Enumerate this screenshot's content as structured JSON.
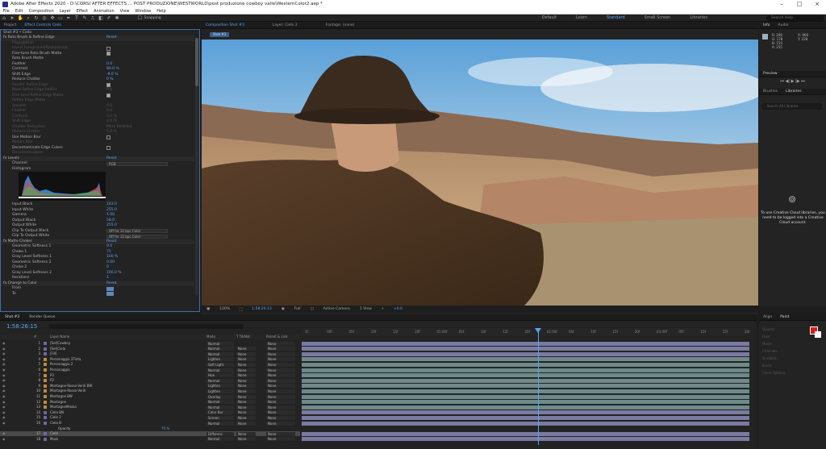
{
  "window": {
    "title": "Adobe After Effects 2020 - D:\\CORSI AFTER EFFECTS ... POST PRODUZIONE\\WESTWORLD\\post produzione cowboy valle\\WesternColor2.aep *"
  },
  "menu": [
    "File",
    "Edit",
    "Composition",
    "Layer",
    "Effect",
    "Animation",
    "View",
    "Window",
    "Help"
  ],
  "toolbar": {
    "snapping": "Snapping"
  },
  "workspaces": [
    {
      "label": "Default"
    },
    {
      "label": "Learn"
    },
    {
      "label": "Standard",
      "active": true
    },
    {
      "label": "Small Screen"
    },
    {
      "label": "Libraries"
    }
  ],
  "search": {
    "placeholder": "Search Help"
  },
  "effect_panel": {
    "tabs": [
      "Project",
      "Effect Controls Cielo"
    ],
    "breadcrumb": "Shot #3 • Cielo",
    "rows": [
      {
        "label": "fx  Roto Brush & Refine Edge",
        "value": "Reset",
        "kind": "sect"
      },
      {
        "label": "Propagation",
        "dim": true
      },
      {
        "label": "Invert Foreground/Background",
        "dim": true,
        "check": false
      },
      {
        "label": "Fine-tune Roto Brush Matte",
        "check": true
      },
      {
        "label": "Roto Brush Matte"
      },
      {
        "label": "Feather",
        "value": "0.0"
      },
      {
        "label": "Contrast",
        "value": "80.0 %"
      },
      {
        "label": "Shift Edge",
        "value": "-9.0 %"
      },
      {
        "label": "Reduce Chatter",
        "value": "0 %"
      },
      {
        "label": "Render Refine Edge",
        "dim": true,
        "check": true
      },
      {
        "label": "Base Refine Edge Radius",
        "dim": true,
        "value": "0.0"
      },
      {
        "label": "Fine-tune Refine Edge Matte",
        "dim": true,
        "check": true
      },
      {
        "label": "Refine Edge Matte",
        "dim": true
      },
      {
        "label": "Smooth",
        "dim": true,
        "value": "0.0"
      },
      {
        "label": "Feather",
        "dim": true,
        "value": "0.0"
      },
      {
        "label": "Contrast",
        "dim": true,
        "value": "0.0 %"
      },
      {
        "label": "Shift Edge",
        "dim": true,
        "value": "0.0 %"
      },
      {
        "label": "Chatter Reduction",
        "dim": true,
        "value": "More Detailed"
      },
      {
        "label": "Reduce Chatter",
        "dim": true,
        "value": "0.0 %"
      },
      {
        "label": "Use Motion Blur",
        "check": false
      },
      {
        "label": "Motion Blur",
        "dim": true
      },
      {
        "label": "Decontaminate Edge Colors",
        "check": false
      },
      {
        "label": "Decontamination",
        "dim": true
      },
      {
        "label": "fx  Levels",
        "value": "Reset",
        "kind": "sect"
      },
      {
        "label": "Channel:",
        "value": "RGB",
        "kind": "dropdown"
      },
      {
        "label": "Histogram",
        "kind": "histogram"
      },
      {
        "label": "Input Black",
        "value": "183.0"
      },
      {
        "label": "Input White",
        "value": "255.0"
      },
      {
        "label": "Gamma",
        "value": "1.00"
      },
      {
        "label": "Output Black",
        "value": "58.0"
      },
      {
        "label": "Output White",
        "value": "255.0"
      },
      {
        "label": "Clip To Output Black",
        "value": "Off for 32 bpc Color",
        "kind": "dropdown"
      },
      {
        "label": "Clip To Output White",
        "value": "Off for 32 bpc Color",
        "kind": "dropdown"
      },
      {
        "label": "fx  Matte Choker",
        "value": "Reset",
        "kind": "sect"
      },
      {
        "label": "Geometric Softness 1",
        "value": "0.0"
      },
      {
        "label": "Choke 1",
        "value": "75"
      },
      {
        "label": "Gray Level Softness 1",
        "value": "100 %"
      },
      {
        "label": "Geometric Softness 2",
        "value": "0.00"
      },
      {
        "label": "Choke 2",
        "value": "0"
      },
      {
        "label": "Gray Level Softness 2",
        "value": "100.0 %"
      },
      {
        "label": "Iterations",
        "value": "1"
      },
      {
        "label": "fx  Change to Color",
        "value": "Reset",
        "kind": "sect"
      },
      {
        "label": "From",
        "kind": "swatch"
      },
      {
        "label": "To",
        "kind": "swatch"
      }
    ]
  },
  "composition": {
    "tabs": [
      "Composition Shot #3",
      "Layer: Cielo 2",
      "Footage: (none)"
    ],
    "shot_label": "Shot #3",
    "viewer_bar": {
      "zoom": "100%",
      "timecode": "1:58:26:15",
      "resolution": "Full",
      "camera": "Active Camera",
      "views": "1 View",
      "exposure": "+0.0"
    }
  },
  "info_panel": {
    "tabs": [
      "Info",
      "Audio"
    ],
    "r": "R: 206",
    "g": "G: 178",
    "b": "B: 150",
    "a": "A: 255",
    "x": "X: 906",
    "y": "Y: 228"
  },
  "preview_panel": {
    "title": "Preview"
  },
  "libraries_panel": {
    "tabs": [
      "Brushes",
      "Libraries"
    ],
    "search": "Search All Libraries",
    "message": "To use Creative Cloud libraries, you need to be logged into a Creative Cloud account."
  },
  "align_panel": {
    "tabs": [
      "Align",
      "Paint"
    ],
    "opacity": "Opacity:",
    "flow": "Flow:",
    "mode": "Mode:",
    "channels": "Channels:",
    "duration": "Duration:",
    "erase": "Erase:",
    "clone": "Clone Options"
  },
  "timeline": {
    "tabs": [
      "Shot #3",
      "Render Queue"
    ],
    "timecode": "1:58:26:15",
    "columns": [
      "#",
      "Layer Name",
      "Mode",
      "T TrkMat",
      "Parent & Link"
    ],
    "ruler": [
      "1f",
      "00f",
      "05f",
      "10f",
      "15f",
      "20f",
      "01:00f",
      "05f",
      "10f",
      "15f",
      "20f",
      "02:00f",
      "05f",
      "10f",
      "15f",
      "20f",
      "03:00f",
      "05f",
      "10f",
      "15f",
      "20f"
    ],
    "layers": [
      {
        "num": "1",
        "name": "[Sel]Cowboy",
        "mode": "Normal",
        "trk": "",
        "parent": "None",
        "color": "#6a6aa0"
      },
      {
        "num": "2",
        "name": "[Sel]Cielo",
        "mode": "Normal",
        "trk": "None",
        "parent": "None",
        "color": "#6a6aa0"
      },
      {
        "num": "3",
        "name": "[Fill]",
        "mode": "Normal",
        "trk": "None",
        "parent": "None",
        "color": "#6a6aa0"
      },
      {
        "num": "4",
        "name": "Personaggio 3Tinta",
        "mode": "Lighten",
        "trk": "None",
        "parent": "None",
        "color": "#c08a3a"
      },
      {
        "num": "5",
        "name": "Personaggio 2",
        "mode": "Soft Light",
        "trk": "None",
        "parent": "None",
        "color": "#c08a3a"
      },
      {
        "num": "6",
        "name": "Personaggio",
        "mode": "Normal",
        "trk": "None",
        "parent": "None",
        "color": "#c08a3a"
      },
      {
        "num": "7",
        "name": "P3",
        "mode": "Hue",
        "trk": "None",
        "parent": "None",
        "color": "#c08a3a"
      },
      {
        "num": "8",
        "name": "P2",
        "mode": "Normal",
        "trk": "None",
        "parent": "None",
        "color": "#c08a3a"
      },
      {
        "num": "9",
        "name": "Montagne-Rosso-Verdi BW",
        "mode": "Lighten",
        "trk": "None",
        "parent": "None",
        "color": "#c08a3a"
      },
      {
        "num": "10",
        "name": "Montagne-Rosso-Verdi",
        "mode": "Lighten",
        "trk": "None",
        "parent": "None",
        "color": "#c08a3a"
      },
      {
        "num": "11",
        "name": "Montagne BW",
        "mode": "Overlay",
        "trk": "None",
        "parent": "None",
        "color": "#c08a3a"
      },
      {
        "num": "12",
        "name": "Montagne",
        "mode": "Normal",
        "trk": "None",
        "parent": "None",
        "color": "#c08a3a"
      },
      {
        "num": "13",
        "name": "MontagneMaska",
        "mode": "Normal",
        "trk": "None",
        "parent": "None",
        "color": "#c08a3a"
      },
      {
        "num": "14",
        "name": "Cielo BN",
        "mode": "Color Bur",
        "trk": "None",
        "parent": "None",
        "color": "#6a6aa0"
      },
      {
        "num": "15",
        "name": "Cielo 2",
        "mode": "Screen",
        "trk": "None",
        "parent": "None",
        "color": "#6a6aa0"
      },
      {
        "num": "16",
        "name": "Cielo B",
        "mode": "Normal",
        "trk": "None",
        "parent": "None",
        "color": "#6a6aa0"
      },
      {
        "num": "",
        "name": "Opacity",
        "mode": "",
        "trk": "",
        "parent": "",
        "color": "",
        "value": "75 %"
      },
      {
        "num": "17",
        "name": "Cielo",
        "mode": "Differenc",
        "trk": "None",
        "parent": "None",
        "color": "#6a6aa0",
        "selected": true
      },
      {
        "num": "18",
        "name": "Mask",
        "mode": "Normal",
        "trk": "None",
        "parent": "None",
        "color": "#6a6aa0"
      }
    ]
  }
}
